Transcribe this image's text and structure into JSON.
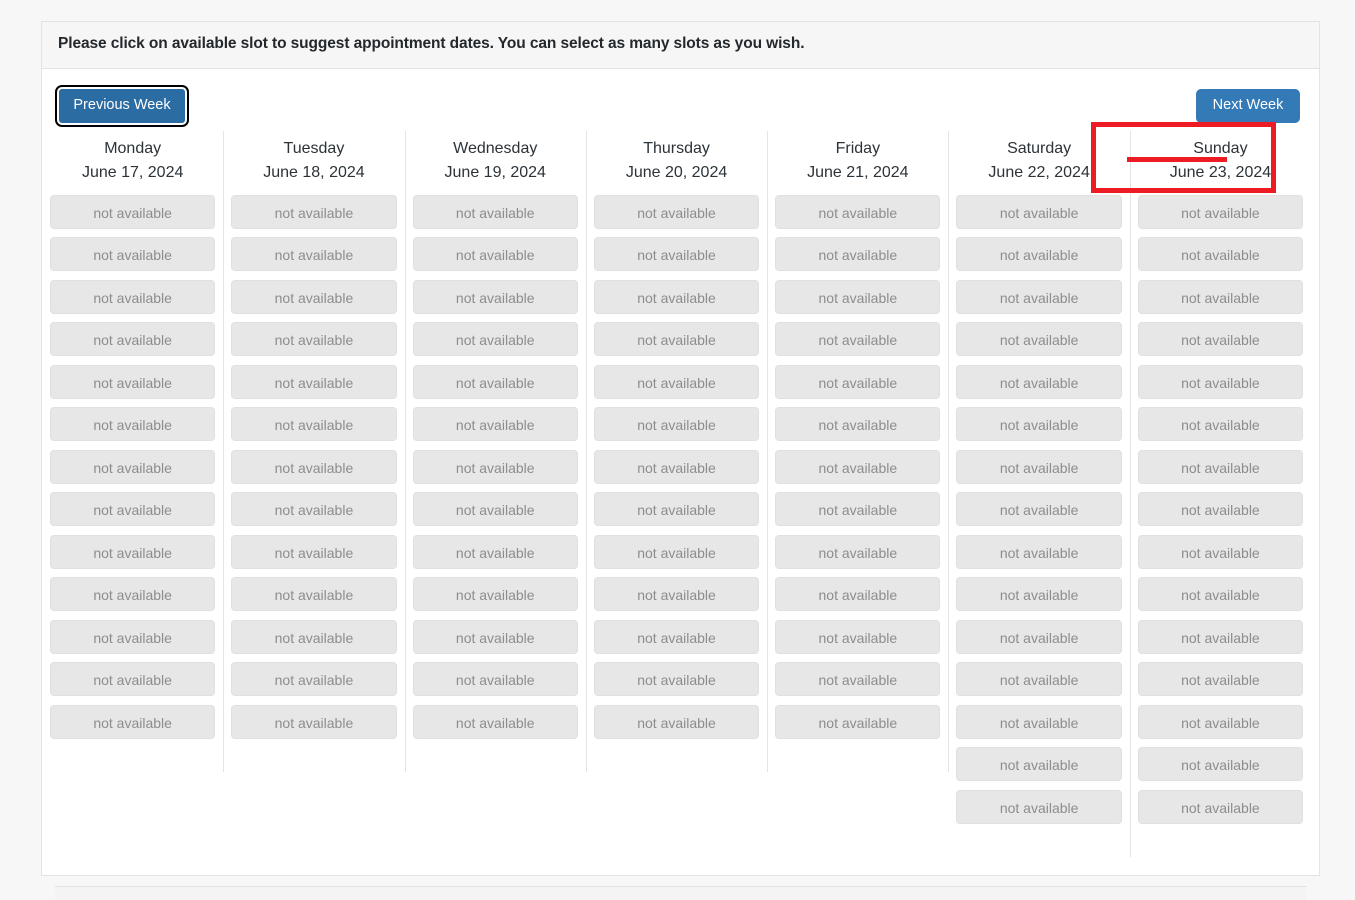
{
  "instruction": "Please click on available slot to suggest appointment dates. You can select as many slots as you wish.",
  "nav": {
    "previous_label": "Previous Week",
    "next_label": "Next Week"
  },
  "slot_label": "not available",
  "colors": {
    "previous_button": "#2b6ca3",
    "next_button": "#337ab7",
    "annotation": "#ed1c24",
    "slot_background": "#e7e7e7",
    "slot_text": "#8d8d8d"
  },
  "annotation": {
    "target": "Sunday",
    "shape": "rectangle-and-underline"
  },
  "week": {
    "days": [
      {
        "name": "Monday",
        "date": "June 17, 2024",
        "slot_count": 13,
        "slots": [
          "not available",
          "not available",
          "not available",
          "not available",
          "not available",
          "not available",
          "not available",
          "not available",
          "not available",
          "not available",
          "not available",
          "not available",
          "not available"
        ]
      },
      {
        "name": "Tuesday",
        "date": "June 18, 2024",
        "slot_count": 13,
        "slots": [
          "not available",
          "not available",
          "not available",
          "not available",
          "not available",
          "not available",
          "not available",
          "not available",
          "not available",
          "not available",
          "not available",
          "not available",
          "not available"
        ]
      },
      {
        "name": "Wednesday",
        "date": "June 19, 2024",
        "slot_count": 13,
        "slots": [
          "not available",
          "not available",
          "not available",
          "not available",
          "not available",
          "not available",
          "not available",
          "not available",
          "not available",
          "not available",
          "not available",
          "not available",
          "not available"
        ]
      },
      {
        "name": "Thursday",
        "date": "June 20, 2024",
        "slot_count": 13,
        "slots": [
          "not available",
          "not available",
          "not available",
          "not available",
          "not available",
          "not available",
          "not available",
          "not available",
          "not available",
          "not available",
          "not available",
          "not available",
          "not available"
        ]
      },
      {
        "name": "Friday",
        "date": "June 21, 2024",
        "slot_count": 13,
        "slots": [
          "not available",
          "not available",
          "not available",
          "not available",
          "not available",
          "not available",
          "not available",
          "not available",
          "not available",
          "not available",
          "not available",
          "not available",
          "not available"
        ]
      },
      {
        "name": "Saturday",
        "date": "June 22, 2024",
        "slot_count": 15,
        "slots": [
          "not available",
          "not available",
          "not available",
          "not available",
          "not available",
          "not available",
          "not available",
          "not available",
          "not available",
          "not available",
          "not available",
          "not available",
          "not available",
          "not available",
          "not available"
        ]
      },
      {
        "name": "Sunday",
        "date": "June 23, 2024",
        "slot_count": 15,
        "slots": [
          "not available",
          "not available",
          "not available",
          "not available",
          "not available",
          "not available",
          "not available",
          "not available",
          "not available",
          "not available",
          "not available",
          "not available",
          "not available",
          "not available",
          "not available"
        ]
      }
    ]
  }
}
